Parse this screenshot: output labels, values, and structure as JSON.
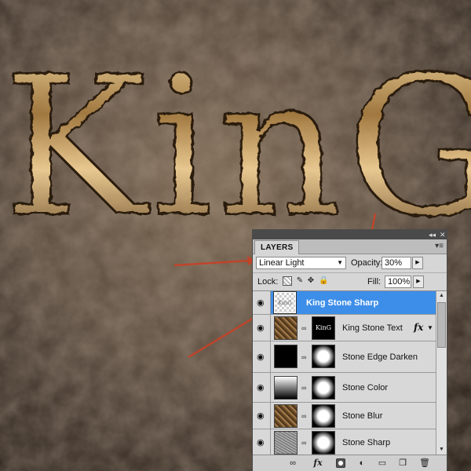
{
  "artwork": {
    "title_text": "KinG"
  },
  "panel": {
    "tab_label": "LAYERS",
    "collapse_icon": "double-chevron-icon",
    "close_icon": "close-icon",
    "menu_icon": "panel-menu-icon",
    "blend_mode": "Linear Light",
    "opacity_label": "Opacity:",
    "opacity_value": "30%",
    "lock_label": "Lock:",
    "fill_label": "Fill:",
    "fill_value": "100%",
    "lock_icons": [
      "lock-transparent-icon",
      "lock-image-icon",
      "lock-position-icon",
      "lock-all-icon"
    ],
    "layers": [
      {
        "name": "King Stone Sharp",
        "selected": true,
        "thumb_text": "KinG"
      },
      {
        "name": "King Stone Text",
        "mask_text": "KinG",
        "fx_label": "fx"
      },
      {
        "name": "Stone Edge Darken"
      },
      {
        "name": "Stone Color"
      },
      {
        "name": "Stone Blur"
      },
      {
        "name": "Stone Sharp"
      }
    ],
    "footer_icons": [
      "link-icon",
      "fx-icon",
      "mask-icon",
      "adjustment-icon",
      "folder-icon",
      "new-layer-icon",
      "trash-icon"
    ],
    "footer_fx_label": "fx"
  },
  "annotation_color": "#c0442a"
}
